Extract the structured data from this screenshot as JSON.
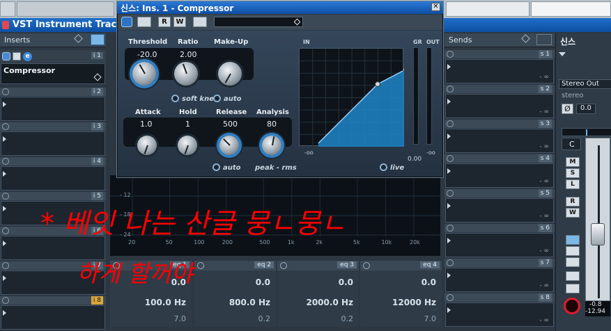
{
  "window": {
    "title": "VST Instrument Track"
  },
  "columns": {
    "inserts": "Inserts",
    "sends": "Sends"
  },
  "inserts": [
    {
      "num": "i 1",
      "plugin": "Compressor"
    },
    {
      "num": "i 2",
      "plugin": ""
    },
    {
      "num": "i 3",
      "plugin": ""
    },
    {
      "num": "i 4",
      "plugin": ""
    },
    {
      "num": "i 5",
      "plugin": ""
    },
    {
      "num": "i 6",
      "plugin": ""
    },
    {
      "num": "i 7",
      "plugin": ""
    },
    {
      "num": "i 8",
      "plugin": ""
    }
  ],
  "sends": [
    {
      "num": "s 1",
      "level": "- ∞"
    },
    {
      "num": "s 2",
      "level": "- ∞"
    },
    {
      "num": "s 3",
      "level": "- ∞"
    },
    {
      "num": "s 4",
      "level": "- ∞"
    },
    {
      "num": "s 5",
      "level": "- ∞"
    },
    {
      "num": "s 6",
      "level": "- ∞"
    },
    {
      "num": "s 7",
      "level": "- ∞"
    },
    {
      "num": "s 8",
      "level": "- ∞"
    }
  ],
  "compressor": {
    "title": "신스: Ins. 1 - Compressor",
    "toolbar": {
      "r": "R",
      "w": "W"
    },
    "params": {
      "threshold": {
        "label": "Threshold",
        "value": "-20.0"
      },
      "ratio": {
        "label": "Ratio",
        "value": "2.00"
      },
      "makeup": {
        "label": "Make-Up",
        "value": ""
      },
      "attack": {
        "label": "Attack",
        "value": "1.0"
      },
      "hold": {
        "label": "Hold",
        "value": "1"
      },
      "release": {
        "label": "Release",
        "value": "500"
      },
      "analysis": {
        "label": "Analysis",
        "value": "80"
      }
    },
    "toggles": {
      "soft_knee": "soft knee",
      "auto": "auto",
      "release_auto": "auto",
      "peak_rms": "peak - rms",
      "live": "live"
    },
    "graph": {
      "in": "IN",
      "gr": "GR",
      "out": "OUT",
      "minus_inf_left": "-oo",
      "minus_inf_right": "-oo",
      "gr_value": "0.00"
    }
  },
  "eq": {
    "db_labels": [
      "- 12",
      "- 18",
      "- 24"
    ],
    "freq_labels": [
      "20",
      "50",
      "100",
      "200",
      "500",
      "1k",
      "2k",
      "5k",
      "10k",
      "20k"
    ],
    "bands": [
      {
        "label": "eq 1",
        "gain": "0.0",
        "freq": "100.0 Hz",
        "q": "7.0"
      },
      {
        "label": "eq 2",
        "gain": "0.0",
        "freq": "800.0 Hz",
        "q": "0.2"
      },
      {
        "label": "eq 3",
        "gain": "0.0",
        "freq": "2000.0 Hz",
        "q": "0.2"
      },
      {
        "label": "eq 4",
        "gain": "0.0",
        "freq": "12000 Hz",
        "q": "7.0"
      }
    ]
  },
  "channel": {
    "name": "신스",
    "output": "Stereo Out",
    "mode": "stereo",
    "pan_value": "0.0",
    "pan": "C",
    "buttons": {
      "m": "M",
      "s": "S",
      "l": "L",
      "r": "R",
      "w": "W"
    },
    "meter1": "-0.8",
    "meter2": "-12.94"
  },
  "annotation": {
    "line1": "* 베잇 나는 산글 뭉ㄴ뭉ㄴ",
    "line2": "하게 할꺼야"
  },
  "colors": {
    "accent": "#2f7fc4",
    "annotation": "#ff0000",
    "curve_fill": "#1e7fc0"
  }
}
